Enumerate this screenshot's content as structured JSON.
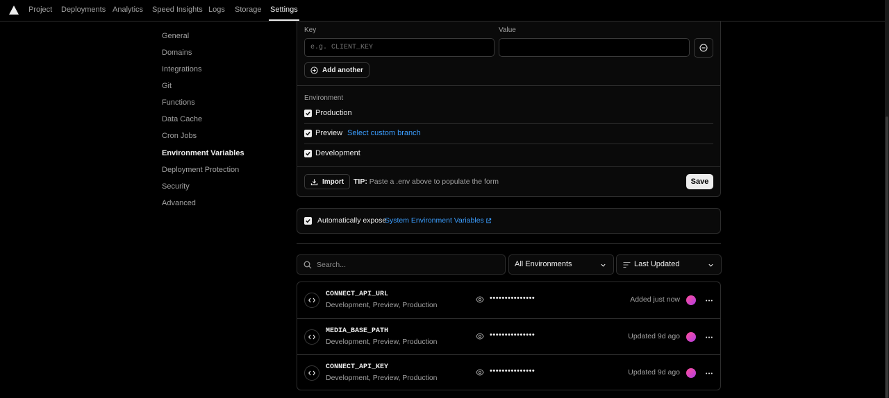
{
  "nav": {
    "tabs": [
      {
        "label": "Project"
      },
      {
        "label": "Deployments"
      },
      {
        "label": "Analytics"
      },
      {
        "label": "Speed Insights"
      },
      {
        "label": "Logs"
      },
      {
        "label": "Storage"
      },
      {
        "label": "Settings",
        "active": true
      }
    ]
  },
  "sidebar": {
    "items": [
      {
        "label": "General"
      },
      {
        "label": "Domains"
      },
      {
        "label": "Integrations"
      },
      {
        "label": "Git"
      },
      {
        "label": "Functions"
      },
      {
        "label": "Data Cache"
      },
      {
        "label": "Cron Jobs"
      },
      {
        "label": "Environment Variables",
        "active": true
      },
      {
        "label": "Deployment Protection"
      },
      {
        "label": "Security"
      },
      {
        "label": "Advanced"
      }
    ]
  },
  "form": {
    "key_label": "Key",
    "value_label": "Value",
    "key_placeholder": "e.g. CLIENT_KEY",
    "value_placeholder": "",
    "add_another_label": "Add another",
    "environment_label": "Environment",
    "environments": [
      {
        "label": "Production",
        "checked": true
      },
      {
        "label": "Preview",
        "checked": true,
        "link": "Select custom branch"
      },
      {
        "label": "Development",
        "checked": true
      }
    ],
    "import_label": "Import",
    "tip_prefix": "TIP:",
    "tip_text": "Paste a .env above to populate the form",
    "save_label": "Save"
  },
  "auto_expose": {
    "checked": true,
    "text": "Automatically expose",
    "link": "System Environment Variables"
  },
  "filters": {
    "search_placeholder": "Search...",
    "environment_select": "All Environments",
    "sort_select": "Last Updated"
  },
  "variables": [
    {
      "name": "CONNECT_API_URL",
      "environments": "Development, Preview, Production",
      "value_masked": "•••••••••••••••",
      "updated": "Added just now"
    },
    {
      "name": "MEDIA_BASE_PATH",
      "environments": "Development, Preview, Production",
      "value_masked": "•••••••••••••••",
      "updated": "Updated 9d ago"
    },
    {
      "name": "CONNECT_API_KEY",
      "environments": "Development, Preview, Production",
      "value_masked": "•••••••••••••••",
      "updated": "Updated 9d ago"
    }
  ],
  "colors": {
    "background": "#000000",
    "text": "#ededed",
    "muted": "#a1a1a1",
    "link": "#3b9eff",
    "border": "#2e2e2e"
  }
}
